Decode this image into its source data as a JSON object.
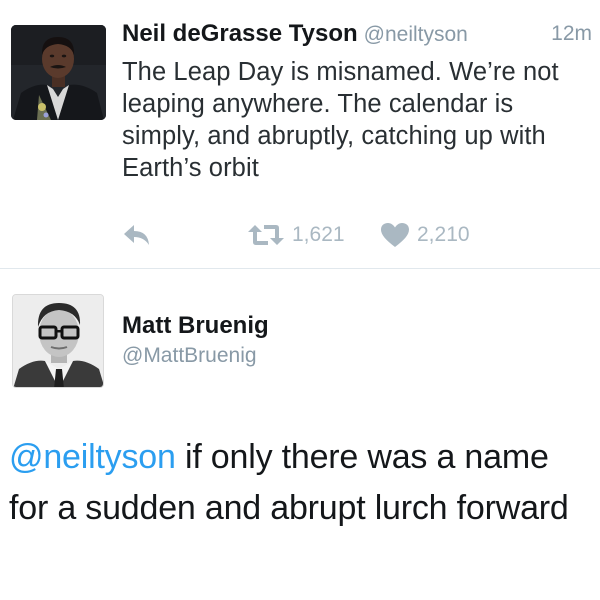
{
  "tweet": {
    "author_name": "Neil deGrasse Tyson",
    "author_handle": "@neiltyson",
    "time": "12m",
    "text": "The Leap Day is misnamed. We’re not leaping anywhere. The calendar is simply, and abruptly, catching up with Earth’s orbit",
    "retweets": "1,621",
    "likes": "2,210"
  },
  "reply": {
    "author_name": "Matt Bruenig",
    "author_handle": "@MattBruenig",
    "mention": "@neiltyson",
    "text": " if only there was a name for a sudden and abrupt lurch forward"
  },
  "colors": {
    "link": "#2b9ef0",
    "muted": "#8899a6",
    "icon": "#aab8c2"
  },
  "icons": {
    "reply": "reply-arrow-icon",
    "retweet": "retweet-icon",
    "like": "heart-icon"
  }
}
